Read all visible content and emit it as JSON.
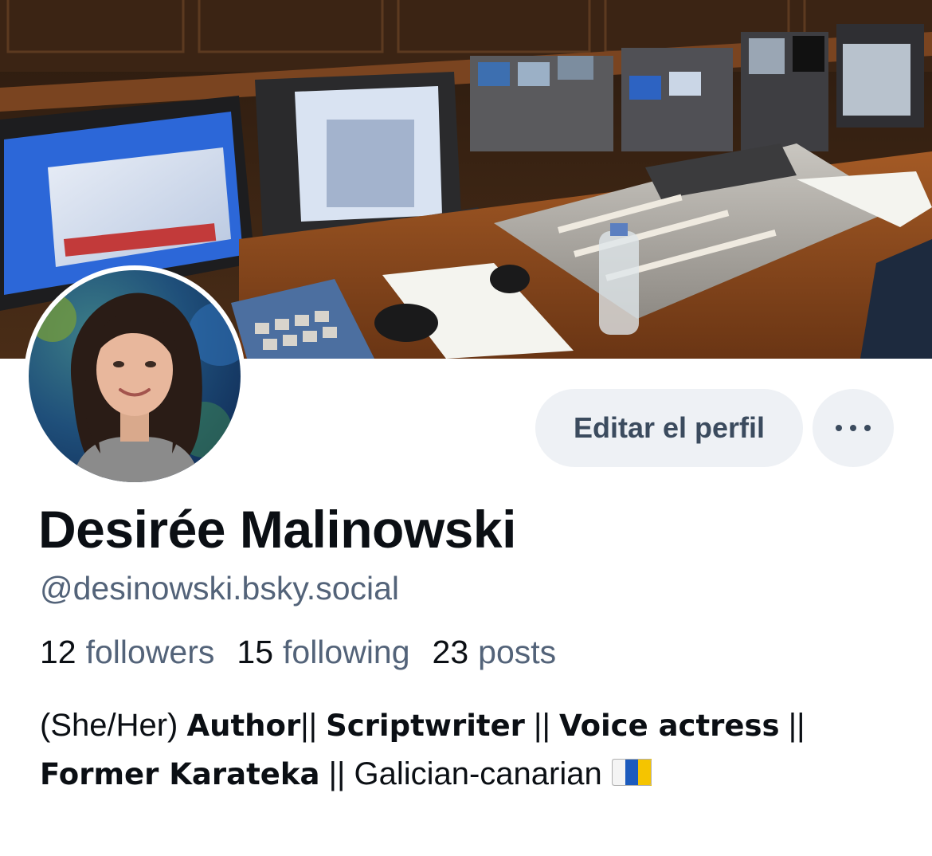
{
  "profile": {
    "display_name": "Desirée Malinowski",
    "handle": "@desinowski.bsky.social",
    "avatar_alt": "profile photo"
  },
  "actions": {
    "edit_label": "Editar el perfil",
    "more_icon": "ellipsis-icon"
  },
  "stats": [
    {
      "count": "12",
      "label": "followers"
    },
    {
      "count": "15",
      "label": "following"
    },
    {
      "count": "23",
      "label": "posts"
    }
  ],
  "bio": {
    "pronouns": "(She/Her)",
    "role_1": "Author",
    "sep_1": "||",
    "role_2": "Scriptwriter",
    "sep_2": "||",
    "role_3": "Voice actress",
    "sep_3": "||",
    "role_4": "Former Karateka",
    "sep_4": "||",
    "origin": "Galician-canarian",
    "flag_icon": "canary-islands-flag-icon"
  },
  "colors": {
    "name": "#0b0f14",
    "secondary": "#536379",
    "button_bg": "#eef1f5",
    "button_text": "#3b4b5e"
  }
}
